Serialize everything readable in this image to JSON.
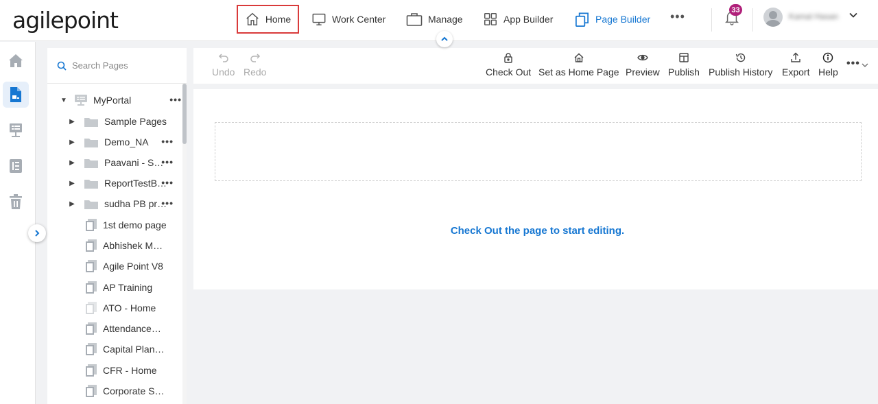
{
  "brand": {
    "logo_text": "agilepoint"
  },
  "topnav": {
    "items": [
      {
        "label": "Home",
        "icon": "home-icon"
      },
      {
        "label": "Work Center",
        "icon": "monitor-icon"
      },
      {
        "label": "Manage",
        "icon": "briefcase-icon"
      },
      {
        "label": "App Builder",
        "icon": "grid-icon"
      },
      {
        "label": "Page Builder",
        "icon": "pages-icon"
      }
    ],
    "more": "•••",
    "notifications_count": "33",
    "user_name": "Kamal Hasan"
  },
  "rail": {
    "items": [
      "home-icon",
      "page-builder-icon",
      "tree-structure-icon",
      "list-icon",
      "trash-icon"
    ]
  },
  "sidebar": {
    "search_placeholder": "Search Pages",
    "tree": [
      {
        "label": "MyPortal",
        "type": "root",
        "expanded": true,
        "menu": true
      },
      {
        "label": "Sample Pages",
        "type": "folder",
        "menu": false
      },
      {
        "label": "Demo_NA",
        "type": "folder",
        "menu": true
      },
      {
        "label": "Paavani - SMS",
        "type": "folder",
        "menu": true
      },
      {
        "label": "ReportTestBi…",
        "type": "folder",
        "menu": true
      },
      {
        "label": "sudha PB pra…",
        "type": "folder",
        "menu": true
      },
      {
        "label": "1st demo page",
        "type": "page"
      },
      {
        "label": "Abhishek Mo…",
        "type": "page"
      },
      {
        "label": "Agile Point V8",
        "type": "page"
      },
      {
        "label": "AP Training",
        "type": "page"
      },
      {
        "label": "ATO - Home",
        "type": "page-light"
      },
      {
        "label": "Attendance_…",
        "type": "page"
      },
      {
        "label": "Capital Planni…",
        "type": "page"
      },
      {
        "label": "CFR - Home",
        "type": "page"
      },
      {
        "label": "Corporate Saf…",
        "type": "page"
      }
    ]
  },
  "toolbar": {
    "undo": "Undo",
    "redo": "Redo",
    "check_out": "Check Out",
    "set_home": "Set as Home Page",
    "preview": "Preview",
    "publish": "Publish",
    "publish_history": "Publish History",
    "export": "Export",
    "help": "Help"
  },
  "canvas": {
    "message": "Check Out the page to start editing."
  },
  "colors": {
    "accent": "#1677d2",
    "highlight_border": "#d93a3a",
    "badge": "#b0207a"
  }
}
